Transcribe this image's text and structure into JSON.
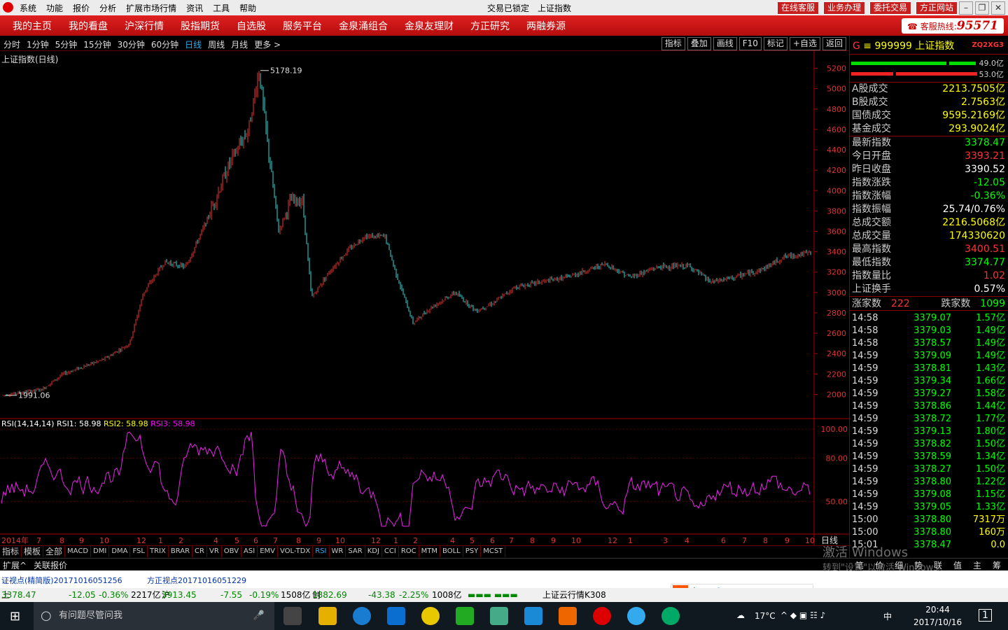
{
  "window": {
    "menu": [
      "系统",
      "功能",
      "报价",
      "分析",
      "扩展市场行情",
      "资讯",
      "工具",
      "帮助"
    ],
    "title_left": "交易已锁定",
    "title": "上证指数",
    "red_buttons": [
      "在线客服",
      "业务办理",
      "委托交易",
      "方正网站"
    ]
  },
  "nav": {
    "items": [
      "我的主页",
      "我的看盘",
      "沪深行情",
      "股指期货",
      "自选股",
      "服务平台",
      "金泉涌组合",
      "金泉友理财",
      "方正研究",
      "两融券源"
    ],
    "hotline_label": "客服热线:",
    "hotline_number": "95571"
  },
  "periods": {
    "items": [
      "分时",
      "1分钟",
      "5分钟",
      "15分钟",
      "30分钟",
      "60分钟",
      "日线",
      "周线",
      "月线",
      "更多 >"
    ],
    "active": "日线"
  },
  "tools": [
    "指标",
    "叠加",
    "画线",
    "F10",
    "标记",
    "+自选",
    "返回"
  ],
  "chart": {
    "title": "上证指数(日线)",
    "high_label": "5178.19",
    "low_label": "1991.06",
    "y_ticks": [
      "5200",
      "5000",
      "4800",
      "4600",
      "4400",
      "4200",
      "4000",
      "3800",
      "3600",
      "3400",
      "3200",
      "3000",
      "2800",
      "2600",
      "2400",
      "2200",
      "2000"
    ],
    "rsi_header": {
      "name": "RSI(14,14,14)",
      "rsi1": "RSI1: 58.98",
      "rsi2": "RSI2: 58.98",
      "rsi3": "RSI3: 58.98"
    },
    "rsi_ticks": [
      "100.00",
      "80.00",
      "50.00"
    ],
    "x_labels": [
      "2014年",
      "7",
      "8",
      "9",
      "10",
      "12",
      "1",
      "2",
      "4",
      "5",
      "6",
      "7",
      "8",
      "9",
      "10",
      "12",
      "1",
      "2",
      "4",
      "5",
      "6",
      "7",
      "8",
      "9",
      "10",
      "12",
      "1",
      "3",
      "4",
      "6",
      "7",
      "8",
      "9",
      "10"
    ],
    "x_axis_right": "日线"
  },
  "chart_data": {
    "type": "candlestick",
    "series": [
      {
        "name": "上证指数",
        "x": [
          "2014-06",
          "2014-12",
          "2015-06-12",
          "2015-08",
          "2016-01",
          "2016-06",
          "2017-01",
          "2017-10"
        ],
        "values": [
          1991.06,
          3200,
          5178.19,
          2900,
          2700,
          2900,
          3100,
          3378.47
        ]
      },
      {
        "name": "RSI1",
        "values": [
          58.98
        ]
      }
    ],
    "ylim": [
      1900,
      5300
    ],
    "rsi_ylim": [
      30,
      100
    ]
  },
  "indicator_tabs": [
    "指标",
    "模板",
    "全部",
    "MACD",
    "DMI",
    "DMA",
    "FSL",
    "TRIX",
    "BRAR",
    "CR",
    "VR",
    "OBV",
    "ASI",
    "EMV",
    "VOL-TDX",
    "RSI",
    "WR",
    "SAR",
    "KDJ",
    "CCI",
    "ROC",
    "MTM",
    "BOLL",
    "PSY",
    "MCST"
  ],
  "ext_row": {
    "left1": "扩展^",
    "left2": "关联报价",
    "right_tabs": [
      "笔",
      "价",
      "细",
      "势",
      "联",
      "值",
      "主",
      "筹"
    ]
  },
  "right": {
    "code": "999999",
    "name": "上证指数",
    "tag": "ZQ2XG3",
    "bar_pct1": "49.0亿",
    "bar_pct2": "53.0亿",
    "vol": [
      {
        "k": "A股成交",
        "v": "2213.7505亿"
      },
      {
        "k": "B股成交",
        "v": "2.7563亿"
      },
      {
        "k": "国债成交",
        "v": "9595.2169亿"
      },
      {
        "k": "基金成交",
        "v": "293.9024亿"
      }
    ],
    "quote": [
      {
        "k": "最新指数",
        "v": "3378.47",
        "c": "grn"
      },
      {
        "k": "今日开盘",
        "v": "3393.21",
        "c": "red"
      },
      {
        "k": "昨日收盘",
        "v": "3390.52",
        "c": "wht"
      },
      {
        "k": "指数涨跌",
        "v": "-12.05",
        "c": "grn"
      },
      {
        "k": "指数涨幅",
        "v": "-0.36%",
        "c": "grn"
      },
      {
        "k": "指数振幅",
        "v": "25.74/0.76%",
        "c": "wht"
      },
      {
        "k": "总成交额",
        "v": "2216.5068亿",
        "c": "yel"
      },
      {
        "k": "总成交量",
        "v": "174330620",
        "c": "yel"
      },
      {
        "k": "最高指数",
        "v": "3400.51",
        "c": "red"
      },
      {
        "k": "最低指数",
        "v": "3374.77",
        "c": "grn"
      },
      {
        "k": "指数量比",
        "v": "1.02",
        "c": "red"
      },
      {
        "k": "上证换手",
        "v": "0.57%",
        "c": "wht"
      }
    ],
    "updown": {
      "up_label": "涨家数",
      "up": "222",
      "down_label": "跌家数",
      "down": "1099"
    },
    "ticks": [
      [
        "14:58",
        "3379.07",
        "1.57亿"
      ],
      [
        "14:58",
        "3379.03",
        "1.49亿"
      ],
      [
        "14:58",
        "3378.57",
        "1.49亿"
      ],
      [
        "14:59",
        "3379.09",
        "1.49亿"
      ],
      [
        "14:59",
        "3378.81",
        "1.43亿"
      ],
      [
        "14:59",
        "3379.34",
        "1.66亿"
      ],
      [
        "14:59",
        "3379.27",
        "1.58亿"
      ],
      [
        "14:59",
        "3378.86",
        "1.44亿"
      ],
      [
        "14:59",
        "3378.72",
        "1.77亿"
      ],
      [
        "14:59",
        "3379.13",
        "1.80亿"
      ],
      [
        "14:59",
        "3378.82",
        "1.50亿"
      ],
      [
        "14:59",
        "3378.59",
        "1.34亿"
      ],
      [
        "14:59",
        "3378.27",
        "1.50亿"
      ],
      [
        "14:59",
        "3378.80",
        "1.22亿"
      ],
      [
        "14:59",
        "3379.08",
        "1.15亿"
      ],
      [
        "14:59",
        "3379.05",
        "1.33亿"
      ],
      [
        "15:00",
        "3378.80",
        "7317万"
      ],
      [
        "15:00",
        "3378.80",
        "160万"
      ],
      [
        "15:01",
        "3378.47",
        "0.0"
      ]
    ]
  },
  "news": {
    "a": "证视点(精简版)20171016051256",
    "b": "方正视点20171016051229"
  },
  "status": {
    "sh_label": "上证",
    "sh": "3378.47",
    "sh_chg": "-12.05",
    "sh_pct": "-0.36%",
    "sh_amt": "2217亿",
    "hs_label": "沪深",
    "hs": "3913.45",
    "hs_chg": "-7.55",
    "hs_pct": "-0.19%",
    "hs_amt": "1508亿",
    "cy_label": "创业",
    "cy": "1882.69",
    "cy_chg": "-43.38",
    "cy_pct": "-2.25%",
    "cy_amt": "1008亿",
    "cloud": "上证云行情K308"
  },
  "watermark": {
    "l1": "激活 Windows",
    "l2": "转到\"设置\"以激活 Windows。"
  },
  "taskbar": {
    "search": "有问题尽管问我",
    "temp": "17°C",
    "ime": "中",
    "time": "20:44",
    "date": "2017/10/16",
    "notif": "1"
  }
}
